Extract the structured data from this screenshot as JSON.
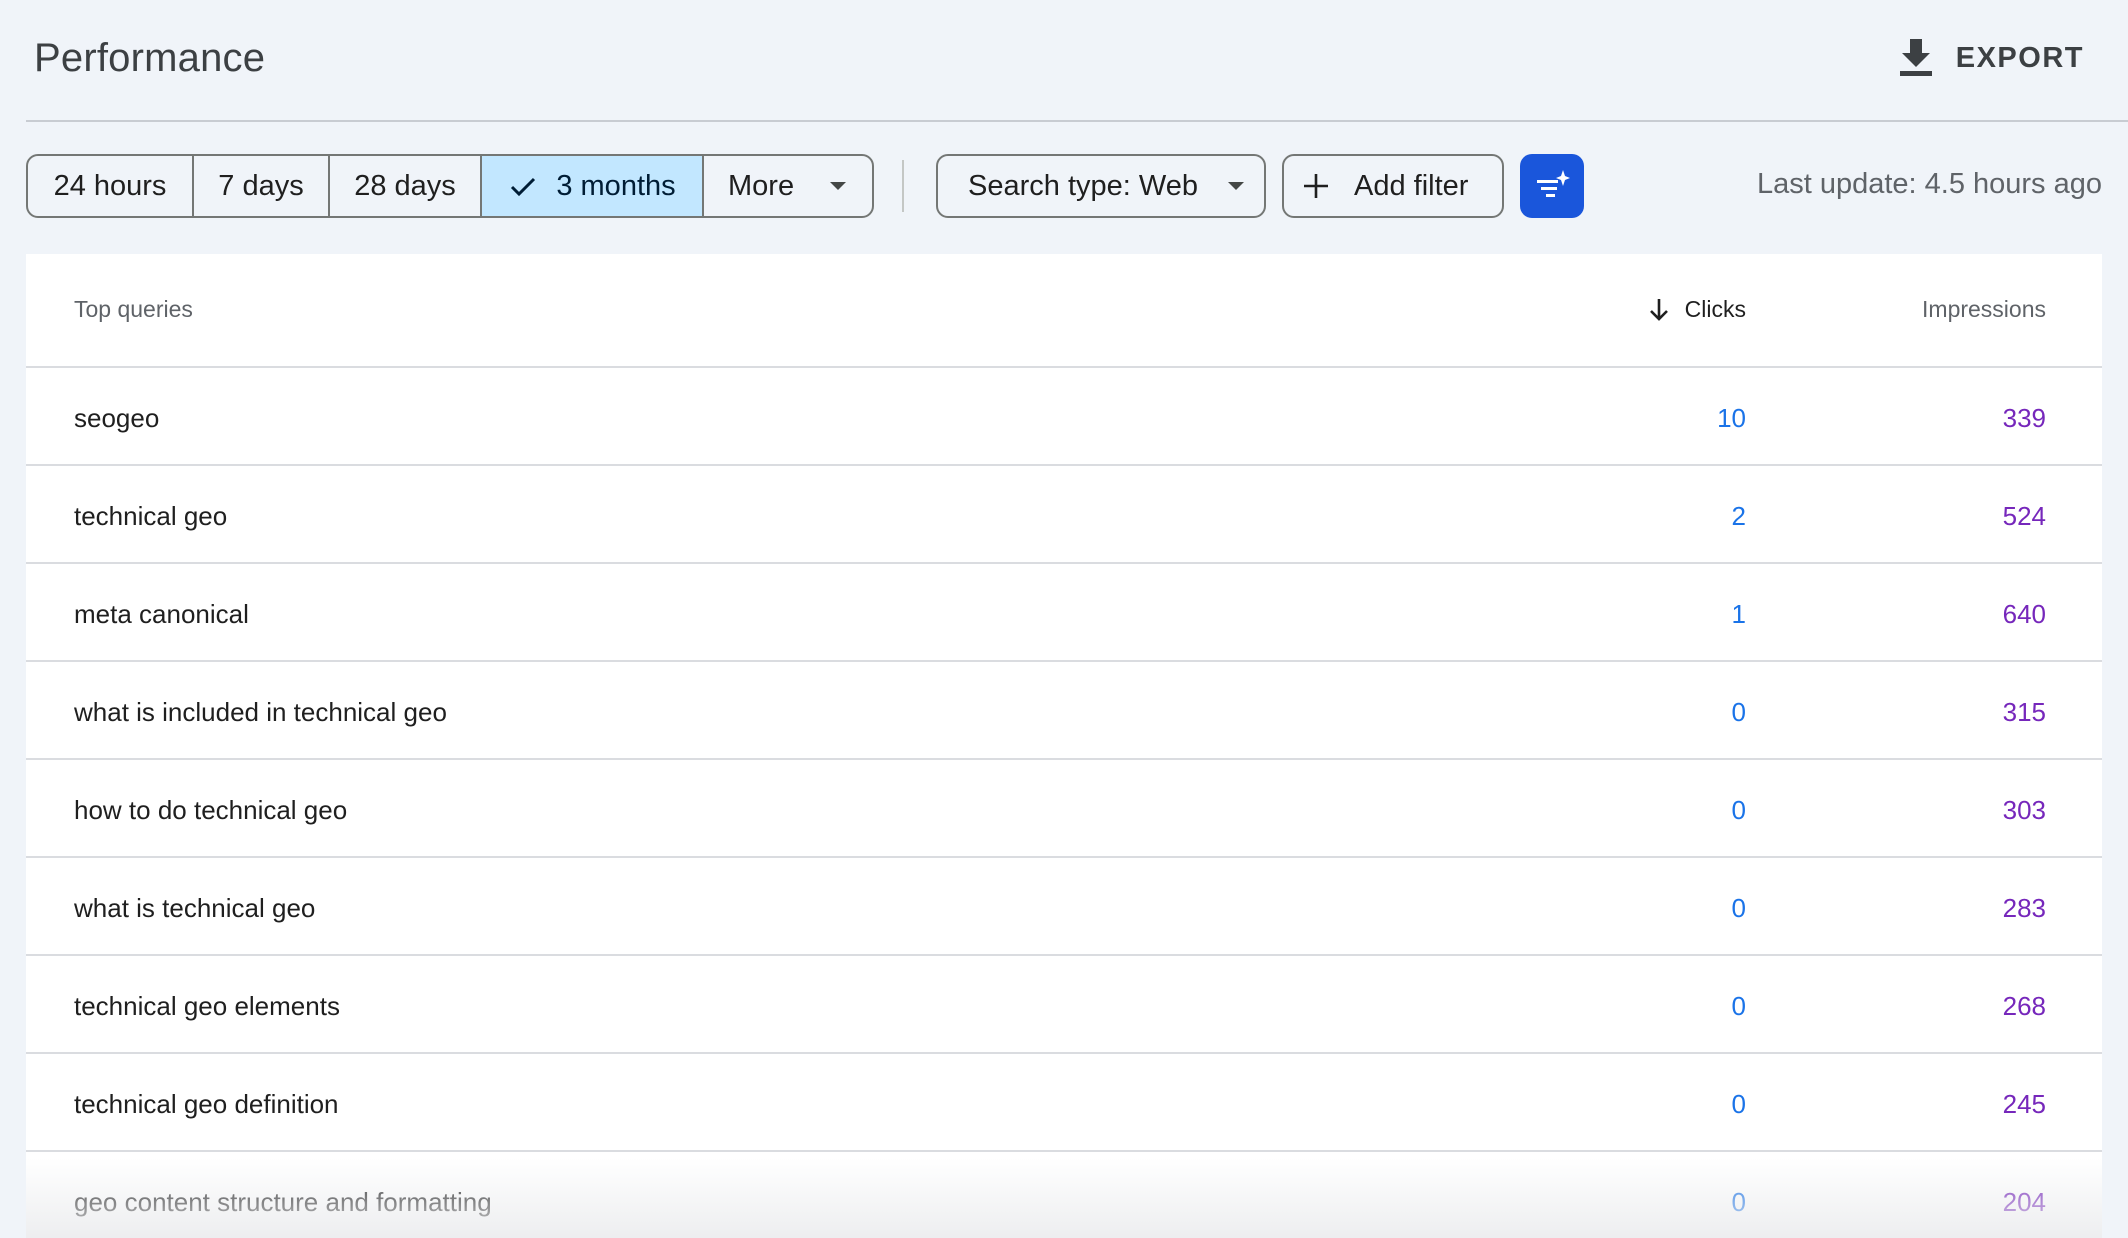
{
  "header": {
    "title": "Performance",
    "export_label": "EXPORT"
  },
  "toolbar": {
    "ranges": [
      "24 hours",
      "7 days",
      "28 days",
      "3 months"
    ],
    "active_range": "3 months",
    "more_label": "More",
    "search_type_label": "Search type: Web",
    "add_filter_label": "Add filter",
    "last_update": "Last update: 4.5 hours ago"
  },
  "table": {
    "columns": {
      "query": "Top queries",
      "clicks": "Clicks",
      "impressions": "Impressions"
    },
    "sort": "clicks-descending",
    "rows": [
      {
        "query": "seogeo",
        "clicks": "10",
        "impressions": "339"
      },
      {
        "query": "technical geo",
        "clicks": "2",
        "impressions": "524"
      },
      {
        "query": "meta canonical",
        "clicks": "1",
        "impressions": "640"
      },
      {
        "query": "what is included in technical geo",
        "clicks": "0",
        "impressions": "315"
      },
      {
        "query": "how to do technical geo",
        "clicks": "0",
        "impressions": "303"
      },
      {
        "query": "what is technical geo",
        "clicks": "0",
        "impressions": "283"
      },
      {
        "query": "technical geo elements",
        "clicks": "0",
        "impressions": "268"
      },
      {
        "query": "technical geo definition",
        "clicks": "0",
        "impressions": "245"
      },
      {
        "query": "geo content structure and formatting",
        "clicks": "0",
        "impressions": "204"
      }
    ]
  },
  "colors": {
    "background": "#f0f4f9",
    "active_chip": "#c2e7ff",
    "ai_button": "#1a56db",
    "clicks": "#1a73e8",
    "impressions": "#7627bb"
  },
  "icons": {
    "export": "download-icon",
    "active_check": "check-icon",
    "dropdown": "caret-down-icon",
    "add_filter": "plus-icon",
    "ai_filter": "sparkle-filter-icon",
    "sort": "arrow-down-icon"
  }
}
